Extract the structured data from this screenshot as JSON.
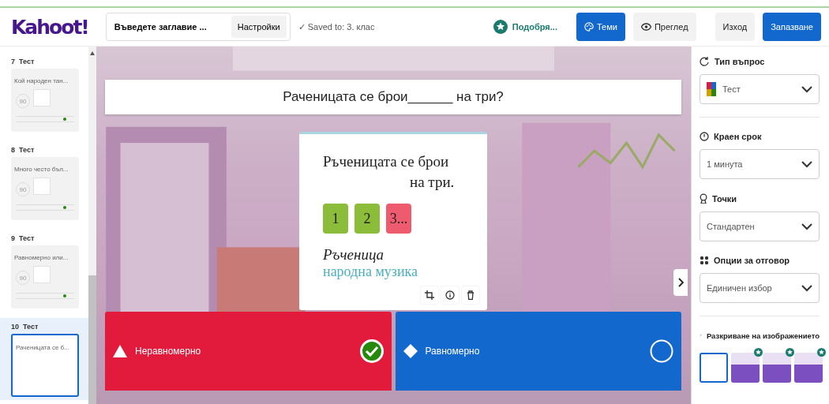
{
  "header": {
    "logo": "Kahoot!",
    "title_field": "Въведете заглавие ...",
    "settings_button": "Настройки",
    "save_status": "✓ Saved to: 3. клас",
    "upgrade_button": "Подобря...",
    "themes_button": "Теми",
    "preview_button": "Преглед",
    "exit_button": "Изход",
    "save_button": "Запазване"
  },
  "slides": [
    {
      "number": "7",
      "type": "Тест",
      "title": "Кой народен тан...",
      "time": "90",
      "selected": false
    },
    {
      "number": "8",
      "type": "Тест",
      "title": "Много често бъл...",
      "time": "90",
      "selected": false
    },
    {
      "number": "9",
      "type": "Тест",
      "title": "Равномерно или...",
      "time": "90",
      "selected": false
    },
    {
      "number": "10",
      "type": "Тест",
      "title": "Раченицата се б...",
      "selected": true
    }
  ],
  "question": "Раченицата се брои______ на три?",
  "image": {
    "line_1": "Ръченицата се брои",
    "line_2": "на три.",
    "tiles": [
      {
        "label": "1",
        "color": "#8cbd3a"
      },
      {
        "label": "2",
        "color": "#8cbd3a"
      },
      {
        "label": "3...",
        "color": "#ee5b6e"
      }
    ],
    "caption_title": "Ръченица",
    "caption_subtitle": "народна музика"
  },
  "answers": [
    {
      "text": "Неравномерно",
      "kind": "triangle",
      "color": "#e21b3c",
      "correct": true
    },
    {
      "text": "Равномерно",
      "kind": "diamond",
      "color": "#1368ce",
      "correct": false
    }
  ],
  "settings": {
    "fields": [
      {
        "kind": "type",
        "label": "Тип въпрос",
        "value": "Тест"
      },
      {
        "kind": "time",
        "label": "Краен срок",
        "value": "1 минута"
      },
      {
        "kind": "points",
        "label": "Точки",
        "value": "Стандартен"
      },
      {
        "kind": "options",
        "label": "Опции за отговор",
        "value": "Единичен избор"
      }
    ],
    "image_reveal": {
      "label": "Разкриване на изображението",
      "options": [
        {
          "selected": true,
          "premium": false
        },
        {
          "selected": false,
          "premium": true
        },
        {
          "selected": false,
          "premium": true
        },
        {
          "selected": false,
          "premium": true
        }
      ]
    }
  }
}
